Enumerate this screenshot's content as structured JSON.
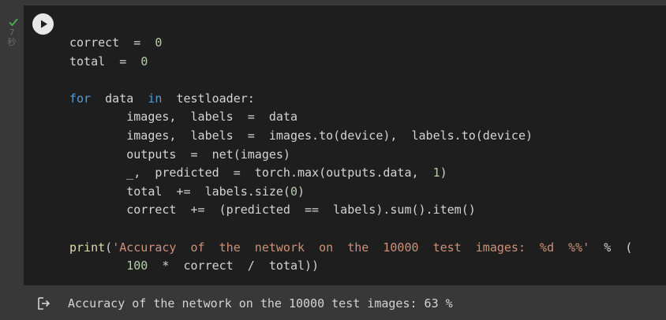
{
  "cell": {
    "status_icon": "checkmark-icon",
    "status_color": "#4caf50",
    "exec_time": "7",
    "exec_unit": "秒",
    "run_icon": "play-icon"
  },
  "code": {
    "lines": [
      [
        [
          "t",
          "correct  =  "
        ],
        [
          "num",
          "0"
        ]
      ],
      [
        [
          "t",
          "total  =  "
        ],
        [
          "num",
          "0"
        ]
      ],
      [],
      [
        [
          "kw",
          "for"
        ],
        [
          "t",
          "  data  "
        ],
        [
          "kw",
          "in"
        ],
        [
          "t",
          "  testloader:"
        ]
      ],
      [
        [
          "t",
          "        images,  labels  =  data"
        ]
      ],
      [
        [
          "t",
          "        images,  labels  =  images.to(device),  labels.to(device)"
        ]
      ],
      [
        [
          "t",
          "        outputs  =  net(images)"
        ]
      ],
      [
        [
          "t",
          "        _,  predicted  =  torch.max(outputs.data,  "
        ],
        [
          "num",
          "1"
        ],
        [
          "t",
          ")"
        ]
      ],
      [
        [
          "t",
          "        total  +=  labels.size("
        ],
        [
          "num",
          "0"
        ],
        [
          "t",
          ")"
        ]
      ],
      [
        [
          "t",
          "        correct  +=  (predicted  ==  labels).sum().item()"
        ]
      ],
      [],
      [
        [
          "fn",
          "print"
        ],
        [
          "t",
          "("
        ],
        [
          "str",
          "'Accuracy  of  the  network  on  the  10000  test  images:  %d  %%'"
        ],
        [
          "t",
          "  %  ("
        ]
      ],
      [
        [
          "t",
          "        "
        ],
        [
          "num",
          "100"
        ],
        [
          "t",
          "  *  correct  /  total))"
        ]
      ]
    ]
  },
  "output": {
    "icon": "output-redirect-icon",
    "text": "Accuracy of the network on the 10000 test images: 63 %"
  }
}
